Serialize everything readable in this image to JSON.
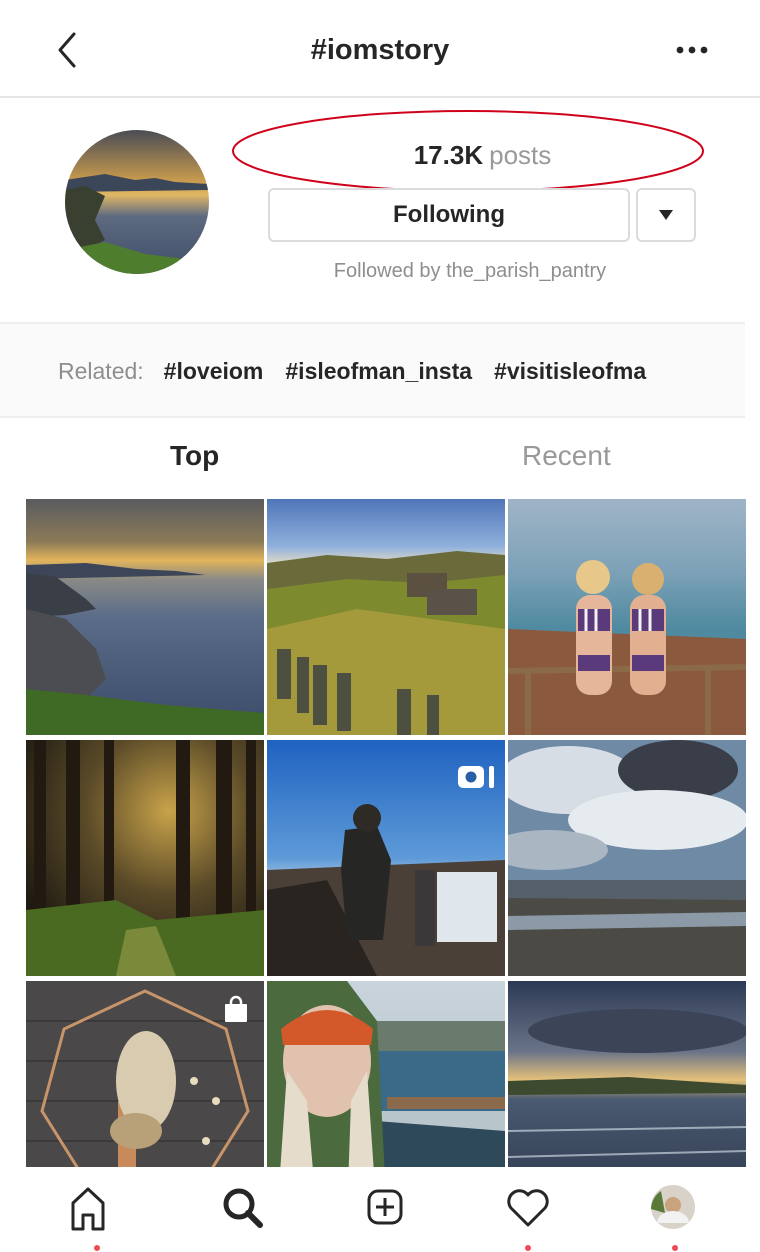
{
  "header": {
    "title": "#iomstory",
    "back_icon": "chevron-left-icon",
    "more_icon": "more-horizontal-icon"
  },
  "profile": {
    "posts_count": "17.3K",
    "posts_label": "posts",
    "following_label": "Following",
    "followed_by": "Followed by the_parish_pantry",
    "annotation_color": "#d0021b"
  },
  "related": {
    "label": "Related:",
    "tags": [
      "#loveiom",
      "#isleofman_insta",
      "#visitisleofma"
    ]
  },
  "tabs": [
    {
      "label": "Top",
      "active": true
    },
    {
      "label": "Recent",
      "active": false
    }
  ],
  "grid": {
    "items": [
      {
        "scene": "coastal-cliffs-sunset"
      },
      {
        "scene": "ruined-cottages-hillside"
      },
      {
        "scene": "two-women-swimsuits-coast"
      },
      {
        "scene": "forest-sunbeams"
      },
      {
        "scene": "man-reading-sign-coast",
        "badge": "video-icon"
      },
      {
        "scene": "cloudy-sky-beach"
      },
      {
        "scene": "pampas-grass-decor",
        "badge": "shopping-bag-icon"
      },
      {
        "scene": "woman-orange-hat-harbour"
      },
      {
        "scene": "bay-sunset-waves"
      }
    ]
  },
  "nav": {
    "items": [
      {
        "icon": "home-icon",
        "notification": true
      },
      {
        "icon": "search-icon",
        "notification": false
      },
      {
        "icon": "add-post-icon",
        "notification": false
      },
      {
        "icon": "heart-icon",
        "notification": true
      },
      {
        "icon": "profile-avatar",
        "notification": true
      }
    ],
    "notification_color": "#ed4956"
  }
}
